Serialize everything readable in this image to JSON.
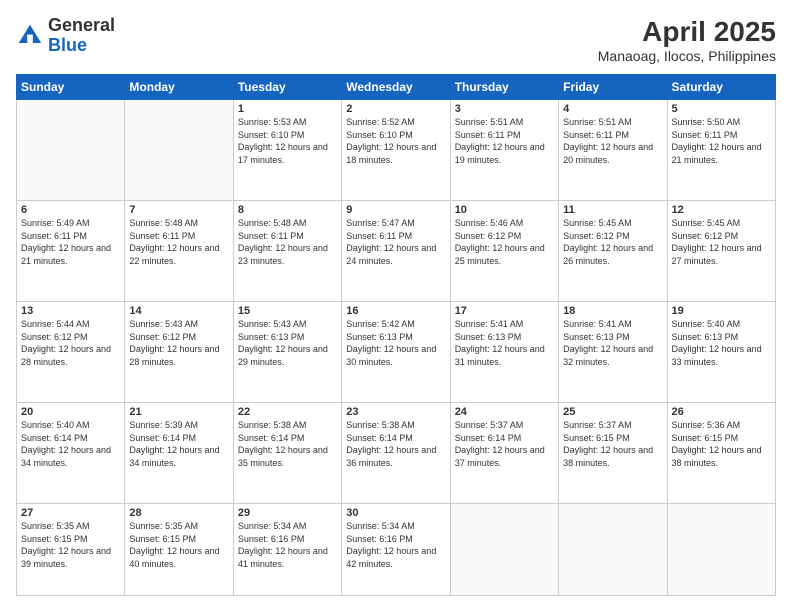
{
  "header": {
    "logo_general": "General",
    "logo_blue": "Blue",
    "title": "April 2025",
    "subtitle": "Manaoag, Ilocos, Philippines"
  },
  "calendar": {
    "days": [
      "Sunday",
      "Monday",
      "Tuesday",
      "Wednesday",
      "Thursday",
      "Friday",
      "Saturday"
    ],
    "weeks": [
      [
        {
          "day": "",
          "info": ""
        },
        {
          "day": "",
          "info": ""
        },
        {
          "day": "1",
          "info": "Sunrise: 5:53 AM\nSunset: 6:10 PM\nDaylight: 12 hours and 17 minutes."
        },
        {
          "day": "2",
          "info": "Sunrise: 5:52 AM\nSunset: 6:10 PM\nDaylight: 12 hours and 18 minutes."
        },
        {
          "day": "3",
          "info": "Sunrise: 5:51 AM\nSunset: 6:11 PM\nDaylight: 12 hours and 19 minutes."
        },
        {
          "day": "4",
          "info": "Sunrise: 5:51 AM\nSunset: 6:11 PM\nDaylight: 12 hours and 20 minutes."
        },
        {
          "day": "5",
          "info": "Sunrise: 5:50 AM\nSunset: 6:11 PM\nDaylight: 12 hours and 21 minutes."
        }
      ],
      [
        {
          "day": "6",
          "info": "Sunrise: 5:49 AM\nSunset: 6:11 PM\nDaylight: 12 hours and 21 minutes."
        },
        {
          "day": "7",
          "info": "Sunrise: 5:48 AM\nSunset: 6:11 PM\nDaylight: 12 hours and 22 minutes."
        },
        {
          "day": "8",
          "info": "Sunrise: 5:48 AM\nSunset: 6:11 PM\nDaylight: 12 hours and 23 minutes."
        },
        {
          "day": "9",
          "info": "Sunrise: 5:47 AM\nSunset: 6:11 PM\nDaylight: 12 hours and 24 minutes."
        },
        {
          "day": "10",
          "info": "Sunrise: 5:46 AM\nSunset: 6:12 PM\nDaylight: 12 hours and 25 minutes."
        },
        {
          "day": "11",
          "info": "Sunrise: 5:45 AM\nSunset: 6:12 PM\nDaylight: 12 hours and 26 minutes."
        },
        {
          "day": "12",
          "info": "Sunrise: 5:45 AM\nSunset: 6:12 PM\nDaylight: 12 hours and 27 minutes."
        }
      ],
      [
        {
          "day": "13",
          "info": "Sunrise: 5:44 AM\nSunset: 6:12 PM\nDaylight: 12 hours and 28 minutes."
        },
        {
          "day": "14",
          "info": "Sunrise: 5:43 AM\nSunset: 6:12 PM\nDaylight: 12 hours and 28 minutes."
        },
        {
          "day": "15",
          "info": "Sunrise: 5:43 AM\nSunset: 6:13 PM\nDaylight: 12 hours and 29 minutes."
        },
        {
          "day": "16",
          "info": "Sunrise: 5:42 AM\nSunset: 6:13 PM\nDaylight: 12 hours and 30 minutes."
        },
        {
          "day": "17",
          "info": "Sunrise: 5:41 AM\nSunset: 6:13 PM\nDaylight: 12 hours and 31 minutes."
        },
        {
          "day": "18",
          "info": "Sunrise: 5:41 AM\nSunset: 6:13 PM\nDaylight: 12 hours and 32 minutes."
        },
        {
          "day": "19",
          "info": "Sunrise: 5:40 AM\nSunset: 6:13 PM\nDaylight: 12 hours and 33 minutes."
        }
      ],
      [
        {
          "day": "20",
          "info": "Sunrise: 5:40 AM\nSunset: 6:14 PM\nDaylight: 12 hours and 34 minutes."
        },
        {
          "day": "21",
          "info": "Sunrise: 5:39 AM\nSunset: 6:14 PM\nDaylight: 12 hours and 34 minutes."
        },
        {
          "day": "22",
          "info": "Sunrise: 5:38 AM\nSunset: 6:14 PM\nDaylight: 12 hours and 35 minutes."
        },
        {
          "day": "23",
          "info": "Sunrise: 5:38 AM\nSunset: 6:14 PM\nDaylight: 12 hours and 36 minutes."
        },
        {
          "day": "24",
          "info": "Sunrise: 5:37 AM\nSunset: 6:14 PM\nDaylight: 12 hours and 37 minutes."
        },
        {
          "day": "25",
          "info": "Sunrise: 5:37 AM\nSunset: 6:15 PM\nDaylight: 12 hours and 38 minutes."
        },
        {
          "day": "26",
          "info": "Sunrise: 5:36 AM\nSunset: 6:15 PM\nDaylight: 12 hours and 38 minutes."
        }
      ],
      [
        {
          "day": "27",
          "info": "Sunrise: 5:35 AM\nSunset: 6:15 PM\nDaylight: 12 hours and 39 minutes."
        },
        {
          "day": "28",
          "info": "Sunrise: 5:35 AM\nSunset: 6:15 PM\nDaylight: 12 hours and 40 minutes."
        },
        {
          "day": "29",
          "info": "Sunrise: 5:34 AM\nSunset: 6:16 PM\nDaylight: 12 hours and 41 minutes."
        },
        {
          "day": "30",
          "info": "Sunrise: 5:34 AM\nSunset: 6:16 PM\nDaylight: 12 hours and 42 minutes."
        },
        {
          "day": "",
          "info": ""
        },
        {
          "day": "",
          "info": ""
        },
        {
          "day": "",
          "info": ""
        }
      ]
    ]
  }
}
